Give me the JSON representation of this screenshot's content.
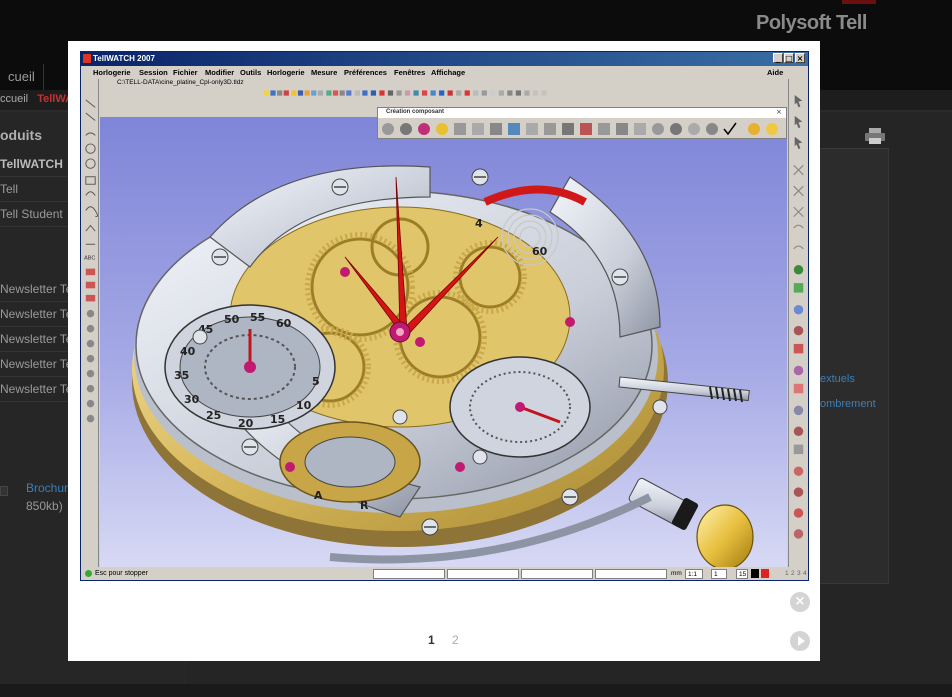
{
  "site": {
    "brand": "Polysoft Tell",
    "nav": [
      "cueil",
      "s"
    ],
    "breadcrumb": [
      "ccueil",
      "TellWATCH"
    ],
    "left": {
      "title": "oduits",
      "items": [
        "TellWATCH",
        "Tell",
        "Tell Student"
      ],
      "newsletters": [
        "Newsletter Te",
        "Newsletter Te",
        "Newsletter Te",
        "Newsletter Te",
        "Newsletter Te"
      ],
      "brochure_link": "Brochur",
      "brochure_size": "850kb)"
    },
    "right_links": [
      "extuels",
      "ombrement"
    ]
  },
  "lightbox": {
    "close_icon": "close-icon",
    "next_icon": "next-icon",
    "pages": [
      "1",
      "2"
    ],
    "current_page": "1"
  },
  "app": {
    "title": "TellWATCH 2007",
    "menu": [
      "Horlogerie",
      "Session",
      "Fichier",
      "Modifier",
      "Outils",
      "Horlogerie",
      "Mesure",
      "Préférences",
      "Fenêtres",
      "Affichage"
    ],
    "help": "Aide",
    "document_path": "C:\\TELL-DATA\\cine_platine_Cpl-only3D.tldz",
    "palette_title": "Création composant",
    "status_text": "Esc pour stopper",
    "status": {
      "unit": "mm",
      "ratio": "1:1",
      "step": "1",
      "count": "15",
      "numbers": [
        "1",
        "2",
        "3",
        "4"
      ]
    },
    "dial": {
      "minute_marks": [
        "4",
        "60"
      ],
      "left_subdial": [
        "60",
        "55",
        "50",
        "45",
        "40",
        "35",
        "30",
        "25",
        "20",
        "15",
        "10",
        "5"
      ],
      "rotor_letters": [
        "A",
        "R"
      ]
    }
  }
}
